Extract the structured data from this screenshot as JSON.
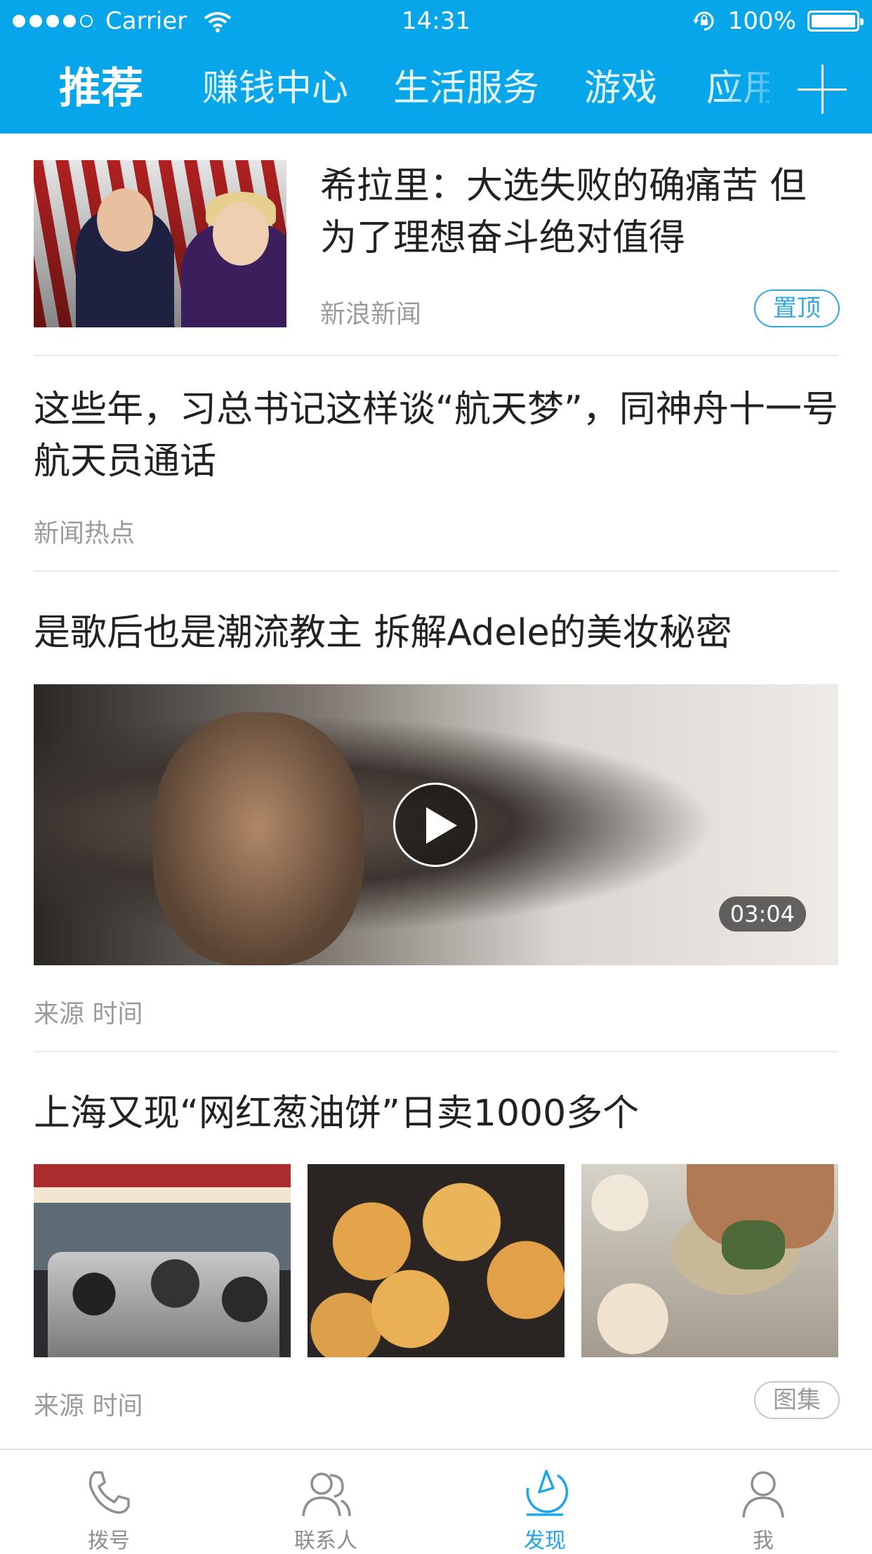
{
  "statusbar": {
    "carrier": "Carrier",
    "time": "14:31",
    "battery": "100%"
  },
  "tabs": [
    {
      "label": "推荐",
      "active": true
    },
    {
      "label": "赚钱中心"
    },
    {
      "label": "生活服务"
    },
    {
      "label": "游戏"
    },
    {
      "label": "应用"
    }
  ],
  "feed": [
    {
      "title": "希拉里：大选失败的确痛苦 但为了理想奋斗绝对值得",
      "source": "新浪新闻",
      "badge": "置顶"
    },
    {
      "title": "这些年，习总书记这样谈“航天梦”，同神舟十一号航天员通话",
      "source": "新闻热点"
    },
    {
      "title": "是歌后也是潮流教主 拆解Adele的美妆秘密",
      "duration": "03:04",
      "source": "来源 时间"
    },
    {
      "title": "上海又现“网红葱油饼”日卖1000多个",
      "source": "来源 时间",
      "badge": "图集"
    }
  ],
  "bottom_nav": [
    {
      "label": "拨号",
      "icon": "phone-icon"
    },
    {
      "label": "联系人",
      "icon": "contacts-icon"
    },
    {
      "label": "发现",
      "icon": "discover-icon",
      "active": true
    },
    {
      "label": "我",
      "icon": "profile-icon"
    }
  ],
  "colors": {
    "header": "#07a6ea",
    "accent": "#1fa6e7",
    "muted": "#9b9b9b"
  }
}
